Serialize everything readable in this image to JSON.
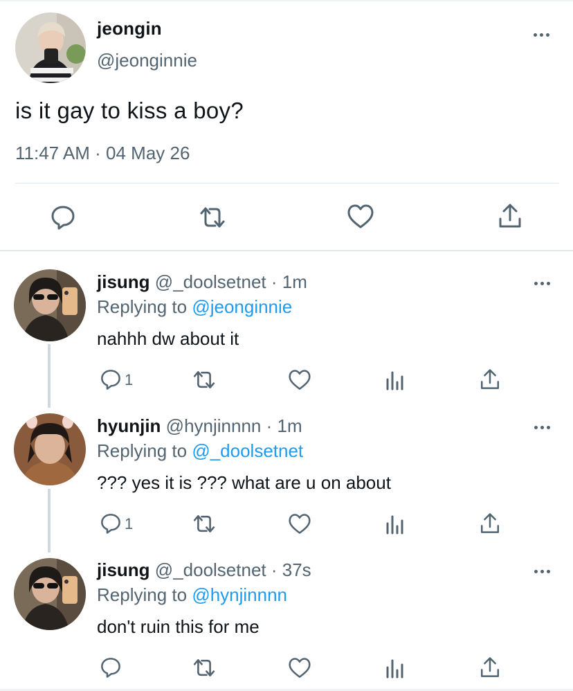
{
  "main_tweet": {
    "display_name": "jeongin",
    "handle": "@jeonginnie",
    "text": "is it gay to kiss a boy?",
    "timestamp": "11:47 AM · 04 May 26",
    "actions": [
      "reply-icon",
      "retweet-icon",
      "like-icon",
      "share-icon"
    ]
  },
  "replies": [
    {
      "display_name": "jisung",
      "meta": "@_doolsetnet · 1m",
      "replying_label": "Replying to",
      "replying_to": "@jeonginnie",
      "text": "nahhh dw about it",
      "reply_count": "1"
    },
    {
      "display_name": "hyunjin",
      "meta": "@hynjinnnn · 1m",
      "replying_label": "Replying to",
      "replying_to": "@_doolsetnet",
      "text": "??? yes it is ??? what are u on about",
      "reply_count": "1"
    },
    {
      "display_name": "jisung",
      "meta": "@_doolsetnet · 37s",
      "replying_label": "Replying to",
      "replying_to": "@hynjinnnn",
      "text": "don't ruin this for me",
      "reply_count": ""
    }
  ],
  "colors": {
    "text": "#0f1419",
    "secondary": "#536471",
    "link": "#1d9bf0",
    "divider": "#e1e8ed",
    "thread_line": "#cfd9de"
  }
}
